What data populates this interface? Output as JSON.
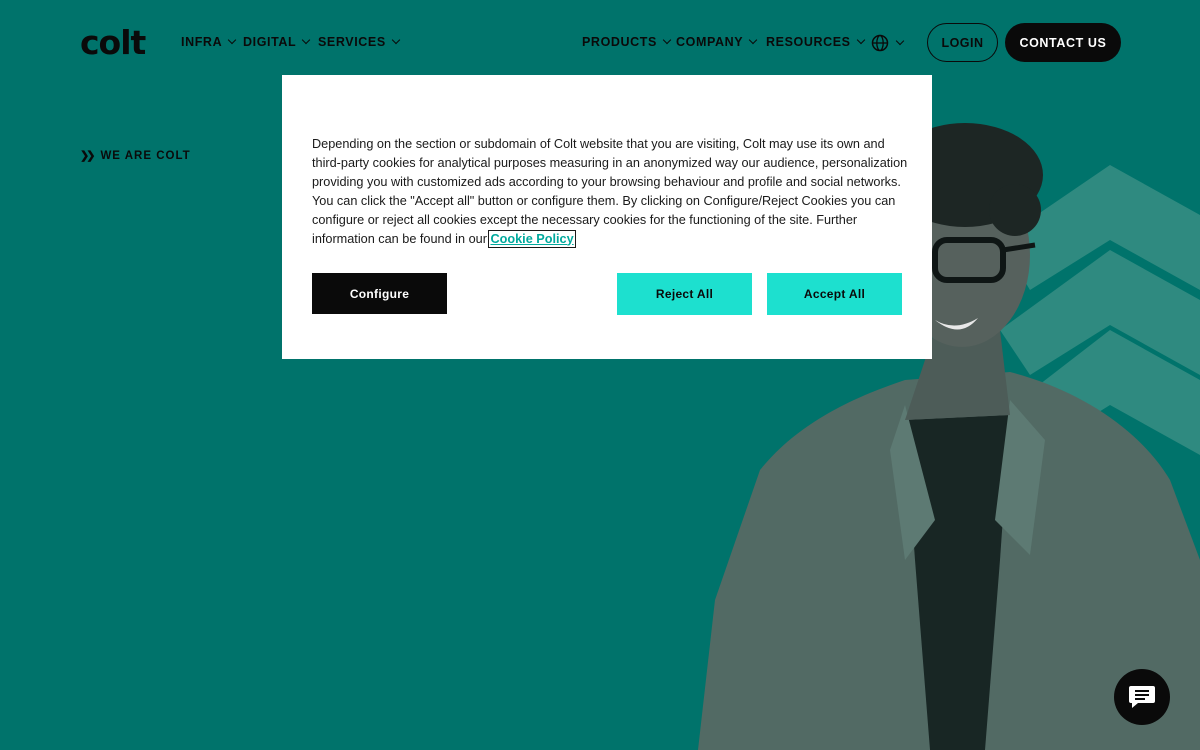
{
  "brand": {
    "logo_text": "colt"
  },
  "nav": {
    "left": [
      {
        "label": "INFRA"
      },
      {
        "label": "DIGITAL"
      },
      {
        "label": "SERVICES"
      }
    ],
    "right": [
      {
        "label": "PRODUCTS"
      },
      {
        "label": "COMPANY"
      },
      {
        "label": "RESOURCES"
      }
    ],
    "language_icon": "globe-icon",
    "login_label": "LOGIN",
    "contact_label": "CONTACT US"
  },
  "hero": {
    "eyebrow": "WE ARE COLT",
    "eyebrow_icon": "double-chevron-icon"
  },
  "cookie_modal": {
    "text": "Depending on the section or subdomain of Colt website that you are visiting, Colt may use its own and third-party cookies for analytical purposes measuring in an anonymized way our audience, personalization providing you with customized ads according to your browsing behaviour and profile and social networks. You can click the \"Accept all\" button or configure them. By clicking on Configure/Reject Cookies you can configure or reject all cookies except the necessary cookies for the functioning of the site. Further information can be found in our",
    "link_label": "Cookie Policy",
    "configure_label": "Configure",
    "reject_label": "Reject All",
    "accept_label": "Accept All"
  },
  "chat": {
    "icon": "chat-icon"
  },
  "colors": {
    "background": "#00736b",
    "accent": "#1de0cf",
    "dark": "#0a0a0a",
    "modal": "#ffffff"
  }
}
